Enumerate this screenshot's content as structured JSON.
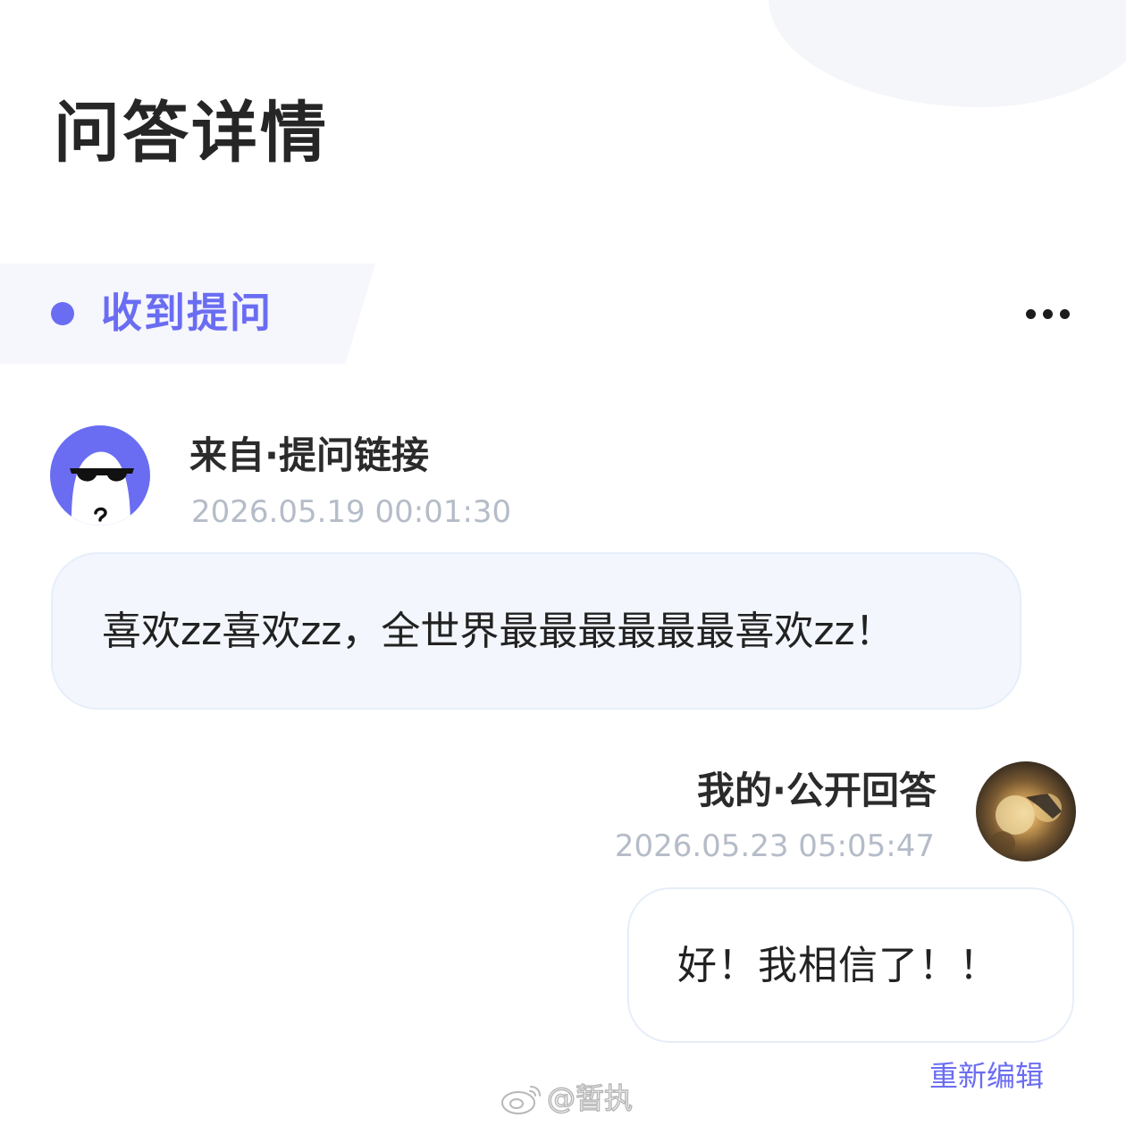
{
  "header": {
    "title": "问答详情"
  },
  "section": {
    "label": "收到提问",
    "more_icon": "more-horizontal-icon"
  },
  "question": {
    "source": "来自·提问链接",
    "time": "2026.05.19 00:01:30",
    "text": "喜欢zz喜欢zz，全世界最最最最最最喜欢zz！",
    "avatar": "sunglasses-ghost-avatar"
  },
  "answer": {
    "label": "我的·公开回答",
    "time": "2026.05.23 05:05:47",
    "text": "好！我相信了！！",
    "reedit": "重新编辑",
    "avatar": "photo-avatar"
  },
  "watermark": {
    "text": "@暂执",
    "icon": "weibo-icon"
  },
  "colors": {
    "accent": "#6a6df2",
    "timestamp": "#b5bcc8",
    "question_bg": "#f3f7fd"
  }
}
